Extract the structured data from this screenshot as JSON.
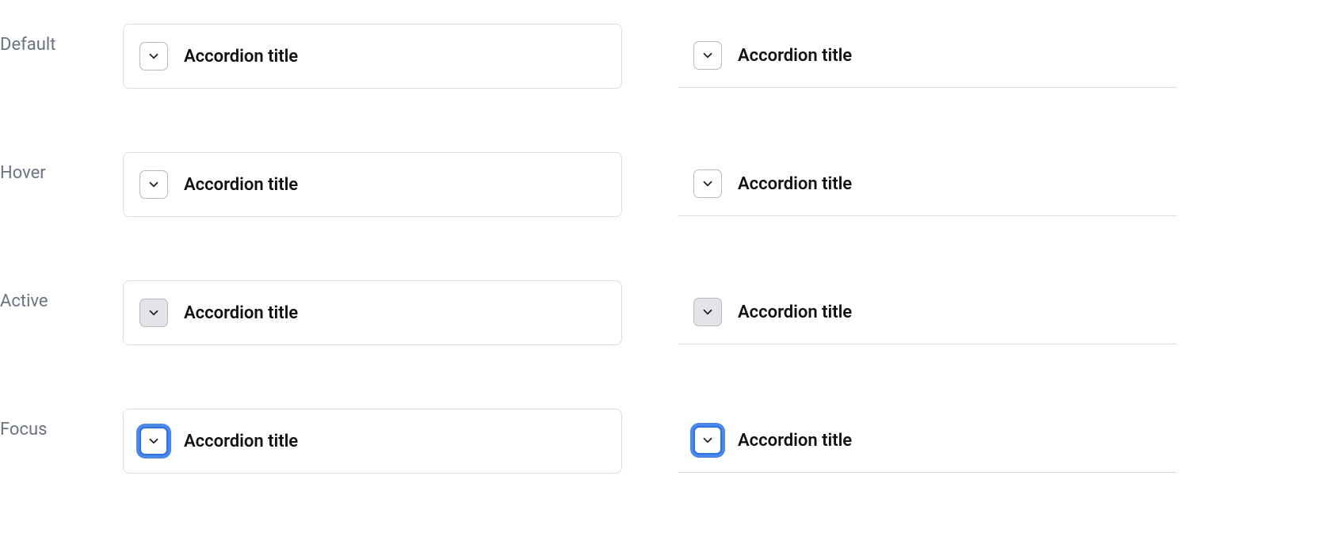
{
  "states": {
    "default": {
      "label": "Default",
      "title": "Accordion title"
    },
    "hover": {
      "label": "Hover",
      "title": "Accordion title"
    },
    "active": {
      "label": "Active",
      "title": "Accordion title"
    },
    "focus": {
      "label": "Focus",
      "title": "Accordion title"
    }
  }
}
